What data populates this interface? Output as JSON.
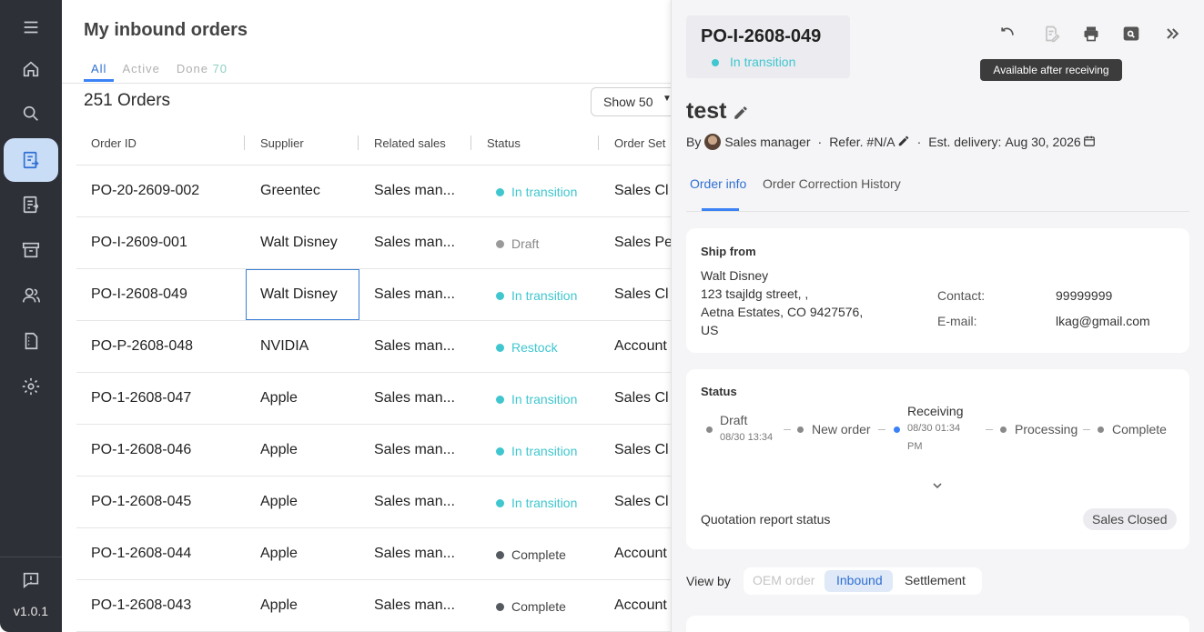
{
  "app": {
    "version": "v1.0.1"
  },
  "sidebar": {
    "items": [
      {
        "icon": "home-icon"
      },
      {
        "icon": "search-icon"
      },
      {
        "icon": "inbound-orders-icon",
        "active": true
      },
      {
        "icon": "outbound-orders-icon"
      },
      {
        "icon": "archive-icon"
      },
      {
        "icon": "users-icon"
      },
      {
        "icon": "documents-icon"
      },
      {
        "icon": "settings-icon"
      }
    ],
    "feedback_icon": "feedback-icon"
  },
  "main": {
    "title": "My inbound orders",
    "tabs": [
      {
        "label": "All",
        "count": ""
      },
      {
        "label": "Active",
        "count": ""
      },
      {
        "label": "Done",
        "count": "70"
      }
    ],
    "orders_count": "251 Orders",
    "show_label": "Show 50",
    "columns": [
      "Order ID",
      "Supplier",
      "Related sales",
      "Status",
      "Order Set"
    ],
    "rows": [
      {
        "id": "PO-20-2609-002",
        "supplier": "Greentec",
        "sales": "Sales man...",
        "status": "In transition",
        "status_color": "#3fc6cf",
        "settle": "Sales Cl"
      },
      {
        "id": "PO-I-2609-001",
        "supplier": "Walt Disney",
        "sales": "Sales man...",
        "status": "Draft",
        "status_color": "#9a9a9a",
        "settle": "Sales Pe"
      },
      {
        "id": "PO-I-2608-049",
        "supplier": "Walt Disney",
        "sales": "Sales man...",
        "status": "In transition",
        "status_color": "#3fc6cf",
        "settle": "Sales Cl"
      },
      {
        "id": "PO-P-2608-048",
        "supplier": "NVIDIA",
        "sales": "Sales man...",
        "status": "Restock",
        "status_color": "#3fc6cf",
        "settle": "Account"
      },
      {
        "id": "PO-1-2608-047",
        "supplier": "Apple",
        "sales": "Sales man...",
        "status": "In transition",
        "status_color": "#3fc6cf",
        "settle": "Sales Cl"
      },
      {
        "id": "PO-1-2608-046",
        "supplier": "Apple",
        "sales": "Sales man...",
        "status": "In transition",
        "status_color": "#3fc6cf",
        "settle": "Sales Cl"
      },
      {
        "id": "PO-1-2608-045",
        "supplier": "Apple",
        "sales": "Sales man...",
        "status": "In transition",
        "status_color": "#3fc6cf",
        "settle": "Sales Cl"
      },
      {
        "id": "PO-1-2608-044",
        "supplier": "Apple",
        "sales": "Sales man...",
        "status": "Complete",
        "status_color": "#555a60",
        "settle": "Account"
      },
      {
        "id": "PO-1-2608-043",
        "supplier": "Apple",
        "sales": "Sales man...",
        "status": "Complete",
        "status_color": "#555a60",
        "settle": "Account"
      }
    ]
  },
  "panel": {
    "po_id": "PO-I-2608-049",
    "po_status": "In transition",
    "tooltip": "Available after receiving",
    "toolbar_icons": [
      "undo-icon",
      "edit-document-icon",
      "print-icon",
      "preview-icon",
      "collapse-panel-icon"
    ],
    "title": "test",
    "by_label": "By",
    "by_user": "Sales manager",
    "refer": "Refer. #N/A",
    "est_delivery_label": "Est. delivery:",
    "est_delivery": "Aug 30, 2026",
    "tabs": [
      "Order info",
      "Order Correction History"
    ],
    "ship_from": {
      "title": "Ship from",
      "lines": [
        "Walt Disney",
        "123 tsajldg street, ,",
        "Aetna Estates, CO 9427576,",
        "US"
      ],
      "contact_label": "Contact:",
      "contact": "99999999",
      "email_label": "E-mail:",
      "email": "lkag@gmail.com"
    },
    "status_card": {
      "title": "Status",
      "steps": [
        {
          "name": "Draft",
          "date": "08/30 13:34"
        },
        {
          "name": "New order",
          "date": ""
        },
        {
          "name": "Receiving",
          "date": "08/30 01:34",
          "date2": "PM",
          "active": true
        },
        {
          "name": "Processing",
          "date": ""
        },
        {
          "name": "Complete",
          "date": ""
        }
      ],
      "quotation_label": "Quotation report status",
      "quotation_value": "Sales Closed"
    },
    "view_by": {
      "label": "View by",
      "options": [
        "OEM order",
        "Inbound",
        "Settlement"
      ],
      "selected": "Inbound"
    }
  }
}
